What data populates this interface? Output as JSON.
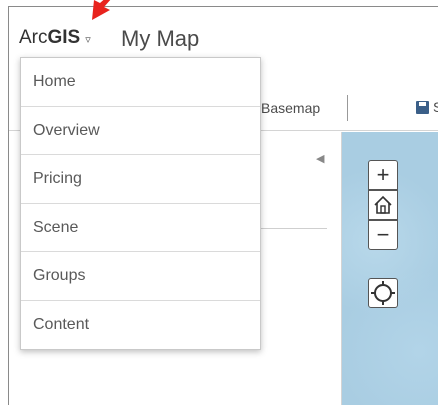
{
  "header": {
    "brand_prefix": "Arc",
    "brand_bold": "GIS",
    "brand_caret": "▿",
    "map_title": "My Map"
  },
  "toolbar": {
    "basemap_label": "Basemap",
    "save_label": "S"
  },
  "left_panel": {
    "collapse_glyph": "◀"
  },
  "map_controls": {
    "zoom_in": "+",
    "zoom_out": "−",
    "home_icon": "home-icon",
    "locate_icon": "locate-icon"
  },
  "dropdown": {
    "items": [
      {
        "label": "Home"
      },
      {
        "label": "Overview"
      },
      {
        "label": "Pricing"
      },
      {
        "label": "Scene"
      },
      {
        "label": "Groups"
      },
      {
        "label": "Content"
      }
    ]
  },
  "colors": {
    "map_water": "#a9cde2",
    "annotation_arrow": "#e8231d",
    "save_icon": "#3b5f88"
  }
}
